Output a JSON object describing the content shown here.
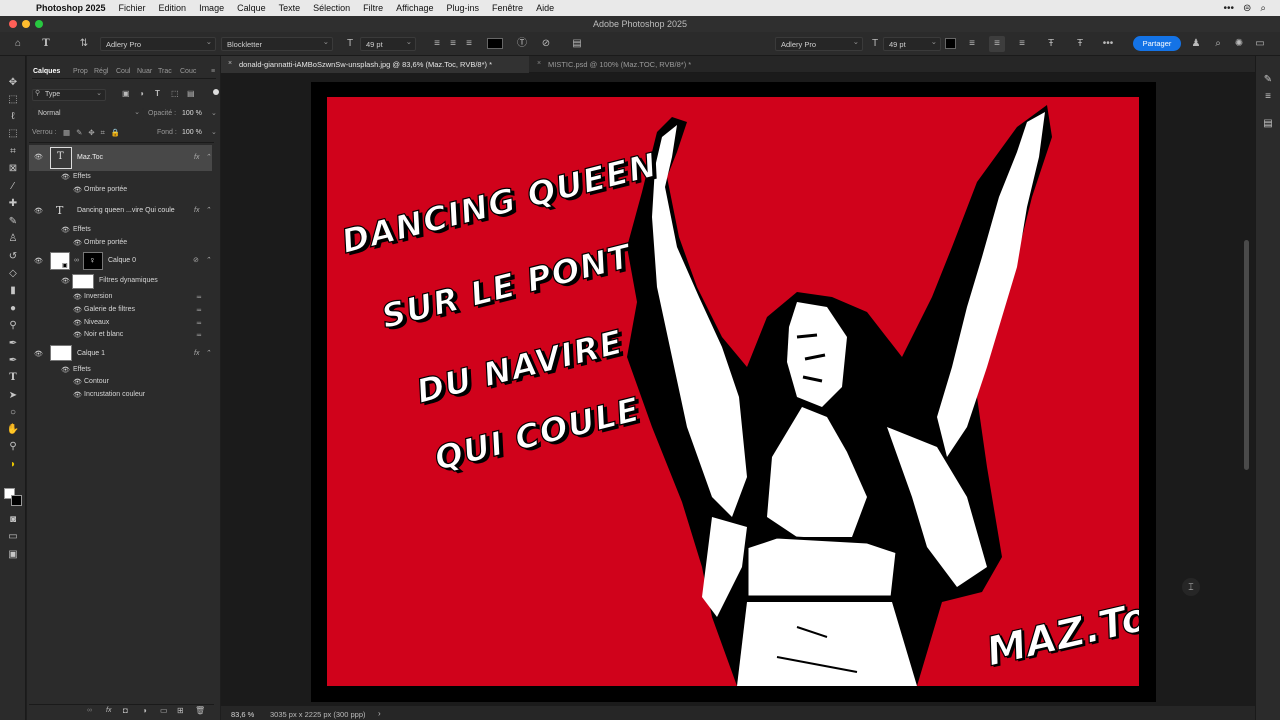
{
  "menubar": {
    "app": "Photoshop 2025",
    "items": [
      "Fichier",
      "Edition",
      "Image",
      "Calque",
      "Texte",
      "Sélection",
      "Filtre",
      "Affichage",
      "Plug-ins",
      "Fenêtre",
      "Aide"
    ]
  },
  "window": {
    "title": "Adobe Photoshop 2025"
  },
  "options_bar": {
    "font_family": "Adlery Pro",
    "font_style": "Blockletter",
    "font_size": "49 pt",
    "font_family_2": "Adlery Pro",
    "font_size_2": "49 pt",
    "share_label": "Partager",
    "text_color": "#000000"
  },
  "layers_panel": {
    "tabs": [
      "Calques",
      "Prop",
      "Régl",
      "Coul",
      "Nuar",
      "Trac",
      "Couc"
    ],
    "filter_label": "Type",
    "blend_mode": "Normal",
    "opacity_label": "Opacité :",
    "opacity_value": "100 %",
    "lock_label": "Verrou :",
    "fill_label": "Fond :",
    "fill_value": "100 %",
    "layers": [
      {
        "name": "Maz.Toc",
        "effects_label": "Effets",
        "effects": [
          "Ombre portée"
        ]
      },
      {
        "name": "Dancing queen ...vire Qui coule",
        "effects_label": "Effets",
        "effects": [
          "Ombre portée"
        ]
      },
      {
        "name": "Calque 0",
        "filters_label": "Filtres dynamiques",
        "filters": [
          "Inversion",
          "Galerie de filtres",
          "Niveaux",
          "Noir et blanc"
        ]
      },
      {
        "name": "Calque 1",
        "effects_label": "Effets",
        "effects": [
          "Contour",
          "Incrustation couleur"
        ]
      }
    ]
  },
  "documents": {
    "tabs": [
      {
        "label": "donald-giannatti-iAMBoSzwnSw-unsplash.jpg @ 83,6% (Maz.Toc, RVB/8*) *",
        "active": true
      },
      {
        "label": "MISTIC.psd @ 100% (Maz.TOC, RVB/8*) *",
        "active": false
      }
    ]
  },
  "artwork": {
    "background_color": "#d0021b",
    "headline_lines": [
      "DANCING QUEEN",
      "SUR LE PONT",
      "DU NAVIRE",
      "QUI COULE"
    ],
    "signature": "MAZ.Toc"
  },
  "status": {
    "zoom": "83,6 %",
    "doc_info": "3035 px x 2225 px (300 ppp)"
  }
}
